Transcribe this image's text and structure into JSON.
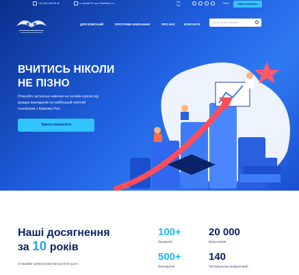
{
  "topbar": {
    "phone": "+38 (067) 356 85 36",
    "address": "м. Кривий Ріг, вул. Ювілейна, 1а",
    "lang_1": "Укр",
    "lang_2": "Рус",
    "signin": "Увійти",
    "register": "Зареєструватися"
  },
  "nav": {
    "items": [
      "ДЛЯ КОМПАНІЙ",
      "ПРОГРАМИ НАВЧАННЯ",
      "ПРО НАС",
      "КОНТАКТИ"
    ],
    "search_placeholder": "Що ви хочете вивчити?"
  },
  "hero": {
    "title_line1": "ВЧИТИСЬ НІКОЛИ",
    "title_line2": "НЕ ПІЗНО",
    "subtitle_line1": "Опануйте актуальні навички на онлайн-курсах від",
    "subtitle_line2": "кращих викладачів на найбільшій освітній",
    "subtitle_line3": "платформі у Кривому Розі",
    "cta": "Зареєструватися"
  },
  "achievements": {
    "title_line1": "Наші досягнення",
    "title_prefix": "за",
    "title_number": "10",
    "title_suffix": "років",
    "description": "З нашими суперсилами ми досягли цього",
    "stats": [
      {
        "value": "100+",
        "label": "Професій"
      },
      {
        "value": "20 000",
        "label": "Випускників"
      },
      {
        "value": "500+",
        "label": "Викладачів"
      },
      {
        "value": "140",
        "label": "Тренувальних майданчиків"
      }
    ]
  },
  "colors": {
    "hero_gradient_start": "#0a2f8a",
    "hero_gradient_end": "#2f7af2",
    "accent_cyan": "#33c5ff",
    "title_dark": "#0a2266"
  },
  "icons": [
    "phone-icon",
    "location-icon",
    "instagram-icon",
    "viber-icon",
    "telegram-icon",
    "facebook-icon",
    "search-icon",
    "logo-owl-icon"
  ]
}
